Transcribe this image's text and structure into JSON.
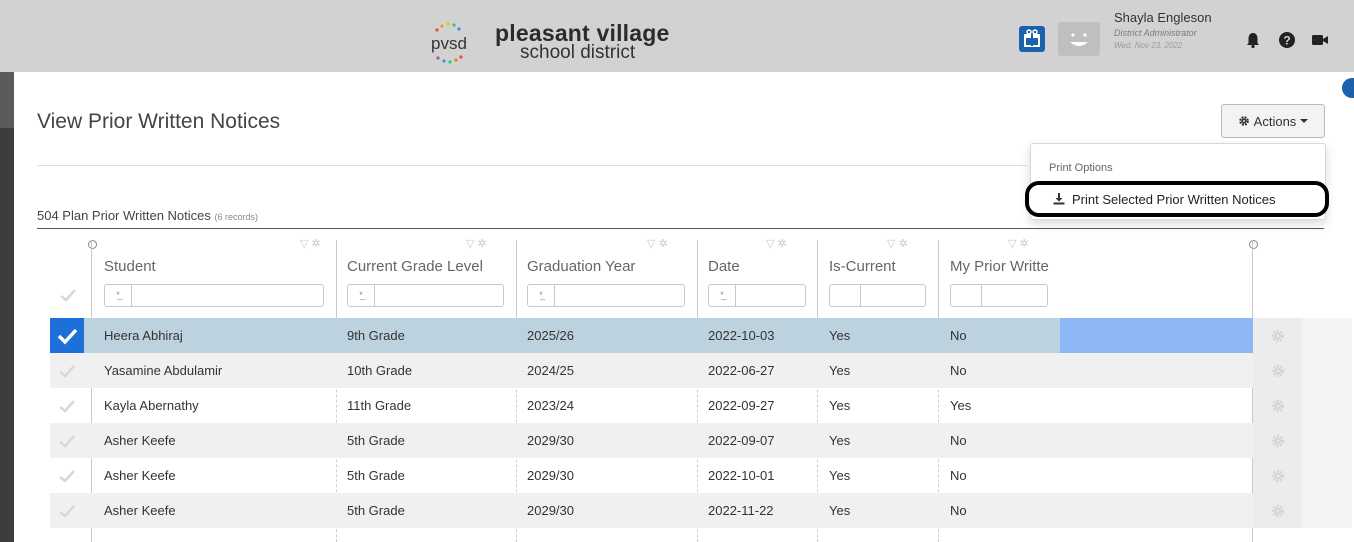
{
  "header": {
    "logo_text": "pvsd",
    "brand_name": "pleasant village",
    "brand_sub": "school district",
    "user_name": "Shayla Engleson",
    "user_role": "District Administrator",
    "user_date": "Wed, Nov 23, 2022",
    "icons": [
      "gift-icon",
      "avatar-icon",
      "bell-icon",
      "help-icon",
      "video-icon"
    ],
    "accent_color": "#1b62ad"
  },
  "page": {
    "title": "View Prior Written Notices",
    "actions_label": "Actions"
  },
  "dropdown": {
    "header": "Print Options",
    "item_label": "Print Selected Prior Written Notices",
    "item_icon": "download-icon"
  },
  "section": {
    "title": "504 Plan Prior Written Notices",
    "count": "(6 records)"
  },
  "table": {
    "columns": [
      "Student",
      "Current Grade Level",
      "Graduation Year",
      "Date",
      "Is-Current",
      "My Prior Writte"
    ],
    "rows": [
      {
        "student": "Heera Abhiraj",
        "grade": "9th Grade",
        "grad_year": "2025/26",
        "date": "2022-10-03",
        "is_current": "Yes",
        "my_prior": "No",
        "selected": true
      },
      {
        "student": "Yasamine Abdulamir",
        "grade": "10th Grade",
        "grad_year": "2024/25",
        "date": "2022-06-27",
        "is_current": "Yes",
        "my_prior": "No",
        "selected": false
      },
      {
        "student": "Kayla Abernathy",
        "grade": "11th Grade",
        "grad_year": "2023/24",
        "date": "2022-09-27",
        "is_current": "Yes",
        "my_prior": "Yes",
        "selected": false
      },
      {
        "student": "Asher Keefe",
        "grade": "5th Grade",
        "grad_year": "2029/30",
        "date": "2022-09-07",
        "is_current": "Yes",
        "my_prior": "No",
        "selected": false
      },
      {
        "student": "Asher Keefe",
        "grade": "5th Grade",
        "grad_year": "2029/30",
        "date": "2022-10-01",
        "is_current": "Yes",
        "my_prior": "No",
        "selected": false
      },
      {
        "student": "Asher Keefe",
        "grade": "5th Grade",
        "grad_year": "2029/30",
        "date": "2022-11-22",
        "is_current": "Yes",
        "my_prior": "No",
        "selected": false
      }
    ],
    "selected_color": "#bcd3df",
    "highlight_color": "#8db6f5",
    "check_color": "#1d6fd9"
  }
}
